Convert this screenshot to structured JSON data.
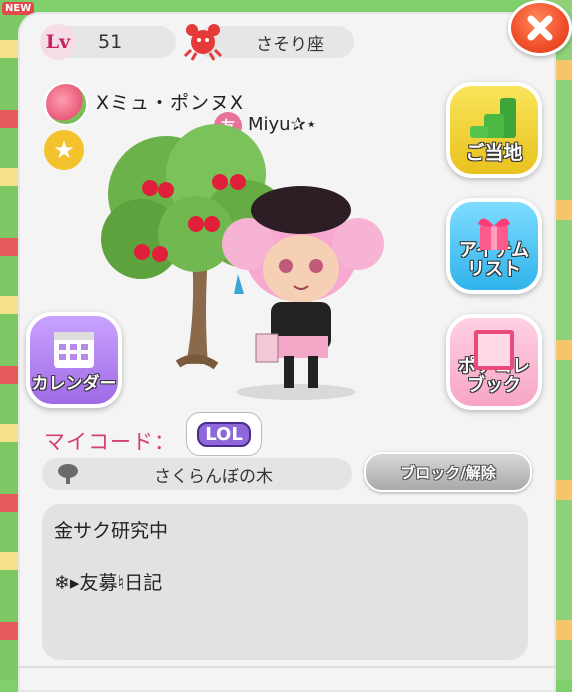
{
  "corner_badge": "NEW",
  "profile": {
    "lv_label": "Lv",
    "level": "51",
    "zodiac": "さそり座",
    "player_name": "Ⅹミュ・ポンヌⅩ",
    "friend_tag": "友",
    "friend_name": "Miyu✰⋆"
  },
  "side_buttons": {
    "local_label": "ご当地",
    "items_label": "アイテム\nリスト",
    "pokecolle_label": "ポケコレ\nブック",
    "calendar_label": "カレンダー",
    "pokecolle_book_text": "ポケコレ"
  },
  "my_code": {
    "label": "マイコード：",
    "badge": "LOL"
  },
  "tree": {
    "name": "さくらんぼの木"
  },
  "block_button": "ブロック/解除",
  "bio": {
    "line1": "金サク研究中",
    "line2": "❄▸友募♮日記"
  },
  "colors": {
    "accent_pink": "#d1406f",
    "close_red": "#f04e2a",
    "panel_bg": "#f4f4f4"
  }
}
